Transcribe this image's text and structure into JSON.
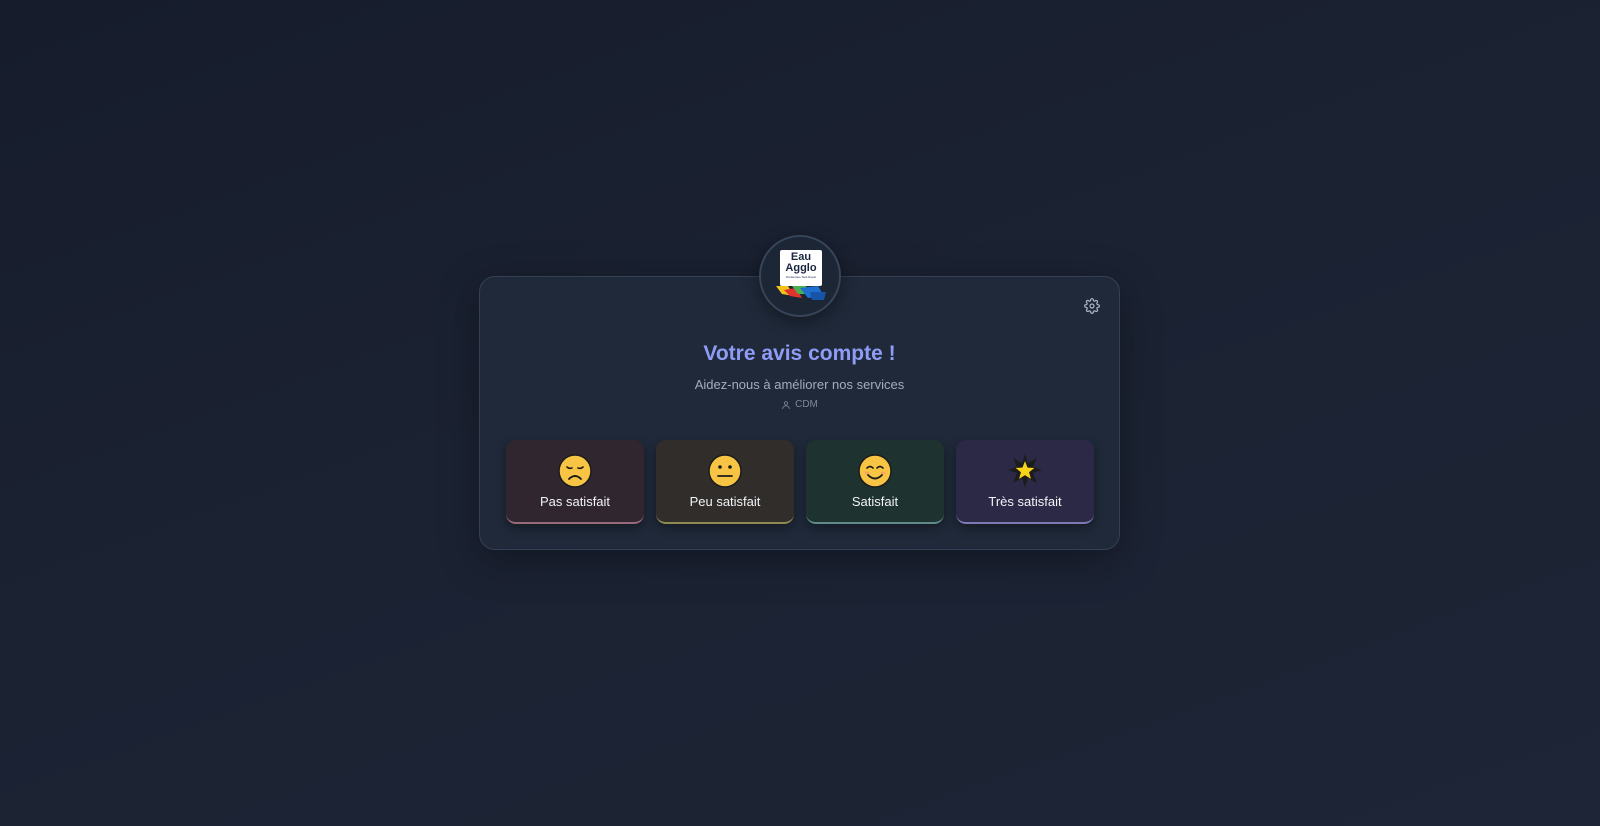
{
  "logo": {
    "line1": "Eau",
    "line2": "Agglo",
    "tagline": "Dunkerque Sud-Ouest"
  },
  "settings": {
    "icon": "gear-icon"
  },
  "header": {
    "title": "Votre avis compte !",
    "subtitle": "Aidez-nous à améliorer nos services"
  },
  "user": {
    "icon": "user-icon",
    "name": "CDM"
  },
  "options": [
    {
      "label": "Pas satisfait",
      "icon": "sad-face-icon"
    },
    {
      "label": "Peu satisfait",
      "icon": "neutral-face-icon"
    },
    {
      "label": "Satisfait",
      "icon": "smiling-face-icon"
    },
    {
      "label": "Très satisfait",
      "icon": "star-icon"
    }
  ],
  "colors": {
    "title": "#8f9cf6",
    "emoji": "#f8c443"
  }
}
